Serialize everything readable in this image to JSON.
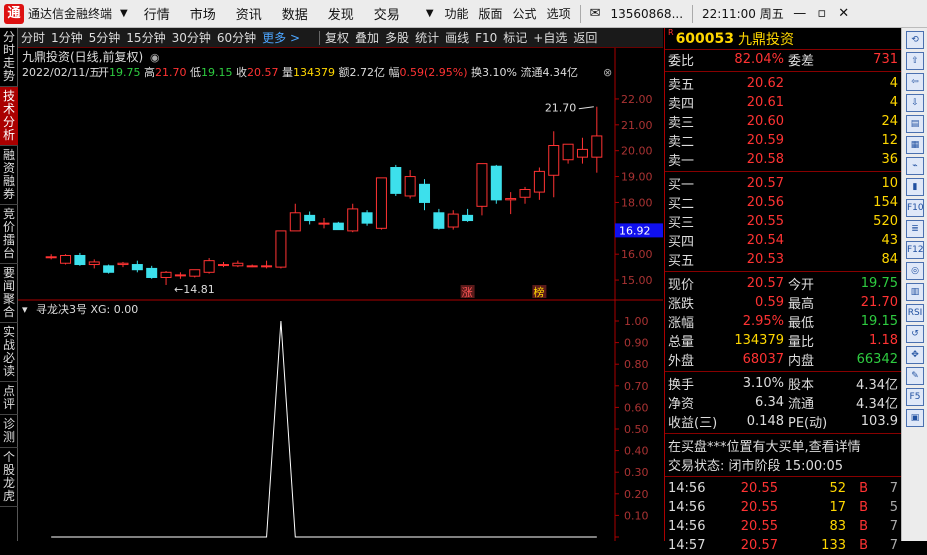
{
  "app": {
    "name": "通达信金融终端",
    "logo": "通"
  },
  "menu": [
    "行情",
    "市场",
    "资讯",
    "数据",
    "发现",
    "交易"
  ],
  "tools": [
    "功能",
    "版面",
    "公式",
    "选项"
  ],
  "account": "13560868...",
  "clock": "22:11:00 周五",
  "left_tabs": [
    "分时走势",
    "技术分析",
    "融资融券",
    "竞价擂台",
    "要闻聚合",
    "实战必读",
    "点评",
    "诊测",
    "个股龙虎"
  ],
  "toolbar": {
    "periods": [
      "分时",
      "1分钟",
      "5分钟",
      "15分钟",
      "30分钟",
      "60分钟"
    ],
    "more": "更多 >",
    "right": [
      "复权",
      "叠加",
      "多股",
      "统计",
      "画线",
      "F10",
      "标记",
      "+自选",
      "返回"
    ]
  },
  "main_chart": {
    "title": "九鼎投资(日线,前复权)",
    "info_date": "2022/02/11/五",
    "info": [
      {
        "k": "开",
        "v": "19.75",
        "c": "#2ecc40"
      },
      {
        "k": "高",
        "v": "21.70",
        "c": "#ff3333"
      },
      {
        "k": "低",
        "v": "19.15",
        "c": "#2ecc40"
      },
      {
        "k": "收",
        "v": "20.57",
        "c": "#ff3333"
      },
      {
        "k": "量",
        "v": "134379",
        "c": "#ffd700"
      },
      {
        "k": "额",
        "v": "2.72亿",
        "c": "#dddddd"
      },
      {
        "k": "幅",
        "v": "0.59(2.95%)",
        "c": "#ff3333"
      },
      {
        "k": "换",
        "v": "3.10%",
        "c": "#dddddd"
      },
      {
        "k": "流通",
        "v": "4.34亿",
        "c": "#dddddd"
      }
    ],
    "hi_label": "21.70",
    "lo_label": "14.81",
    "current_price_tag": "16.92",
    "markers": [
      "涨",
      "榜"
    ]
  },
  "indicator": {
    "title": "寻龙决3号 XG: 0.00"
  },
  "chart_data": [
    {
      "type": "candlestick",
      "ylim": [
        14.5,
        22.5
      ],
      "yticks": [
        15.0,
        16.0,
        17.0,
        18.0,
        19.0,
        20.0,
        21.0,
        22.0
      ],
      "candles": [
        {
          "o": 15.9,
          "h": 16.0,
          "l": 15.8,
          "c": 15.9
        },
        {
          "o": 15.65,
          "h": 16.0,
          "l": 15.6,
          "c": 15.95
        },
        {
          "o": 15.95,
          "h": 16.05,
          "l": 15.55,
          "c": 15.6
        },
        {
          "o": 15.6,
          "h": 15.8,
          "l": 15.45,
          "c": 15.7
        },
        {
          "o": 15.55,
          "h": 15.6,
          "l": 15.25,
          "c": 15.3
        },
        {
          "o": 15.6,
          "h": 15.7,
          "l": 15.5,
          "c": 15.65
        },
        {
          "o": 15.6,
          "h": 15.75,
          "l": 15.3,
          "c": 15.4
        },
        {
          "o": 15.45,
          "h": 15.55,
          "l": 15.05,
          "c": 15.1
        },
        {
          "o": 15.1,
          "h": 15.35,
          "l": 14.81,
          "c": 15.3
        },
        {
          "o": 15.2,
          "h": 15.3,
          "l": 15.05,
          "c": 15.2
        },
        {
          "o": 15.15,
          "h": 15.4,
          "l": 15.1,
          "c": 15.4
        },
        {
          "o": 15.3,
          "h": 15.85,
          "l": 15.25,
          "c": 15.75
        },
        {
          "o": 15.6,
          "h": 15.7,
          "l": 15.5,
          "c": 15.6
        },
        {
          "o": 15.55,
          "h": 15.75,
          "l": 15.5,
          "c": 15.65
        },
        {
          "o": 15.55,
          "h": 15.6,
          "l": 15.5,
          "c": 15.55
        },
        {
          "o": 15.55,
          "h": 15.75,
          "l": 15.45,
          "c": 15.55
        },
        {
          "o": 15.5,
          "h": 16.9,
          "l": 15.45,
          "c": 16.9
        },
        {
          "o": 16.9,
          "h": 17.95,
          "l": 16.9,
          "c": 17.6
        },
        {
          "o": 17.5,
          "h": 17.65,
          "l": 17.15,
          "c": 17.3
        },
        {
          "o": 17.2,
          "h": 17.4,
          "l": 17.0,
          "c": 17.2
        },
        {
          "o": 17.2,
          "h": 17.25,
          "l": 16.95,
          "c": 16.95
        },
        {
          "o": 16.9,
          "h": 17.95,
          "l": 16.85,
          "c": 17.75
        },
        {
          "o": 17.6,
          "h": 17.7,
          "l": 17.1,
          "c": 17.2
        },
        {
          "o": 17.0,
          "h": 18.95,
          "l": 16.95,
          "c": 18.95
        },
        {
          "o": 19.35,
          "h": 19.45,
          "l": 18.25,
          "c": 18.35
        },
        {
          "o": 18.25,
          "h": 19.25,
          "l": 18.15,
          "c": 19.0
        },
        {
          "o": 18.7,
          "h": 18.9,
          "l": 17.7,
          "c": 18.0
        },
        {
          "o": 17.6,
          "h": 17.75,
          "l": 16.95,
          "c": 17.0
        },
        {
          "o": 17.05,
          "h": 17.7,
          "l": 16.95,
          "c": 17.55
        },
        {
          "o": 17.5,
          "h": 17.75,
          "l": 17.25,
          "c": 17.3
        },
        {
          "o": 17.85,
          "h": 19.5,
          "l": 17.5,
          "c": 19.5
        },
        {
          "o": 19.4,
          "h": 19.45,
          "l": 17.95,
          "c": 18.1
        },
        {
          "o": 18.1,
          "h": 18.4,
          "l": 17.55,
          "c": 18.15
        },
        {
          "o": 18.2,
          "h": 18.6,
          "l": 17.95,
          "c": 18.5
        },
        {
          "o": 18.4,
          "h": 19.35,
          "l": 18.1,
          "c": 19.2
        },
        {
          "o": 19.05,
          "h": 20.75,
          "l": 18.2,
          "c": 20.2
        },
        {
          "o": 19.65,
          "h": 20.25,
          "l": 19.5,
          "c": 20.25
        },
        {
          "o": 19.75,
          "h": 20.5,
          "l": 19.5,
          "c": 20.05
        },
        {
          "o": 19.75,
          "h": 21.7,
          "l": 19.15,
          "c": 20.57
        }
      ]
    },
    {
      "type": "line",
      "name": "XG",
      "ylim": [
        0,
        1
      ],
      "yticks": [
        0.0,
        0.1,
        0.2,
        0.3,
        0.4,
        0.5,
        0.6,
        0.7,
        0.8,
        0.9,
        1.0
      ],
      "values": [
        0,
        0,
        0,
        0,
        0,
        0,
        0,
        0,
        0,
        0,
        0,
        0,
        0,
        0,
        0,
        0,
        1,
        0,
        0,
        0,
        0,
        0,
        0,
        0,
        0,
        0,
        0,
        0,
        0,
        0,
        0,
        0,
        0,
        0,
        0,
        0,
        0,
        0,
        0
      ]
    }
  ],
  "quote": {
    "code": "600053",
    "name": "九鼎投资",
    "flag": "R",
    "weibi": {
      "label": "委比",
      "value": "82.04%",
      "diff_label": "委差",
      "diff": "731"
    },
    "asks": [
      {
        "label": "卖五",
        "price": "20.62",
        "vol": "4"
      },
      {
        "label": "卖四",
        "price": "20.61",
        "vol": "4"
      },
      {
        "label": "卖三",
        "price": "20.60",
        "vol": "24"
      },
      {
        "label": "卖二",
        "price": "20.59",
        "vol": "12"
      },
      {
        "label": "卖一",
        "price": "20.58",
        "vol": "36"
      }
    ],
    "bids": [
      {
        "label": "买一",
        "price": "20.57",
        "vol": "10"
      },
      {
        "label": "买二",
        "price": "20.56",
        "vol": "154"
      },
      {
        "label": "买三",
        "price": "20.55",
        "vol": "520"
      },
      {
        "label": "买四",
        "price": "20.54",
        "vol": "43"
      },
      {
        "label": "买五",
        "price": "20.53",
        "vol": "84"
      }
    ],
    "stats": [
      {
        "l1": "现价",
        "v1": "20.57",
        "c1": "#ff3333",
        "l2": "今开",
        "v2": "19.75",
        "c2": "#2ecc40"
      },
      {
        "l1": "涨跌",
        "v1": "0.59",
        "c1": "#ff3333",
        "l2": "最高",
        "v2": "21.70",
        "c2": "#ff3333"
      },
      {
        "l1": "涨幅",
        "v1": "2.95%",
        "c1": "#ff3333",
        "l2": "最低",
        "v2": "19.15",
        "c2": "#2ecc40"
      },
      {
        "l1": "总量",
        "v1": "134379",
        "c1": "#ffd700",
        "l2": "量比",
        "v2": "1.18",
        "c2": "#ff3333"
      },
      {
        "l1": "外盘",
        "v1": "68037",
        "c1": "#ff3333",
        "l2": "内盘",
        "v2": "66342",
        "c2": "#2ecc40"
      }
    ],
    "stats2": [
      {
        "l1": "换手",
        "v1": "3.10%",
        "l2": "股本",
        "v2": "4.34亿"
      },
      {
        "l1": "净资",
        "v1": "6.34",
        "l2": "流通",
        "v2": "4.34亿"
      },
      {
        "l1": "收益(三)",
        "v1": "0.148",
        "l2": "PE(动)",
        "v2": "103.9"
      }
    ],
    "notice": "在买盘***位置有大买单,查看详情",
    "status": "交易状态: 闭市阶段 15:00:05",
    "ticks": [
      {
        "t": "14:56",
        "p": "20.55",
        "v": "52",
        "d": "B",
        "n": "7"
      },
      {
        "t": "14:56",
        "p": "20.55",
        "v": "17",
        "d": "B",
        "n": "5"
      },
      {
        "t": "14:56",
        "p": "20.55",
        "v": "83",
        "d": "B",
        "n": "7"
      },
      {
        "t": "14:57",
        "p": "20.57",
        "v": "133",
        "d": "B",
        "n": "7"
      }
    ]
  },
  "right_icons": [
    "back-icon",
    "forward-icon",
    "up-icon",
    "down-icon",
    "book-icon",
    "grid-icon",
    "chart-icon",
    "candle-icon",
    "f10-icon",
    "list-icon",
    "f12-icon",
    "circle-icon",
    "bars-icon",
    "rsi-icon",
    "undo-icon",
    "move-icon",
    "pencil-icon",
    "f5-icon",
    "save-icon"
  ],
  "right_icon_labels": [
    "⟲",
    "⇧",
    "⇦",
    "⇩",
    "▤",
    "▦",
    "⌁",
    "▮",
    "F10",
    "≣",
    "F12",
    "◎",
    "▥",
    "RSI",
    "↺",
    "✥",
    "✎",
    "F5",
    "▣"
  ]
}
